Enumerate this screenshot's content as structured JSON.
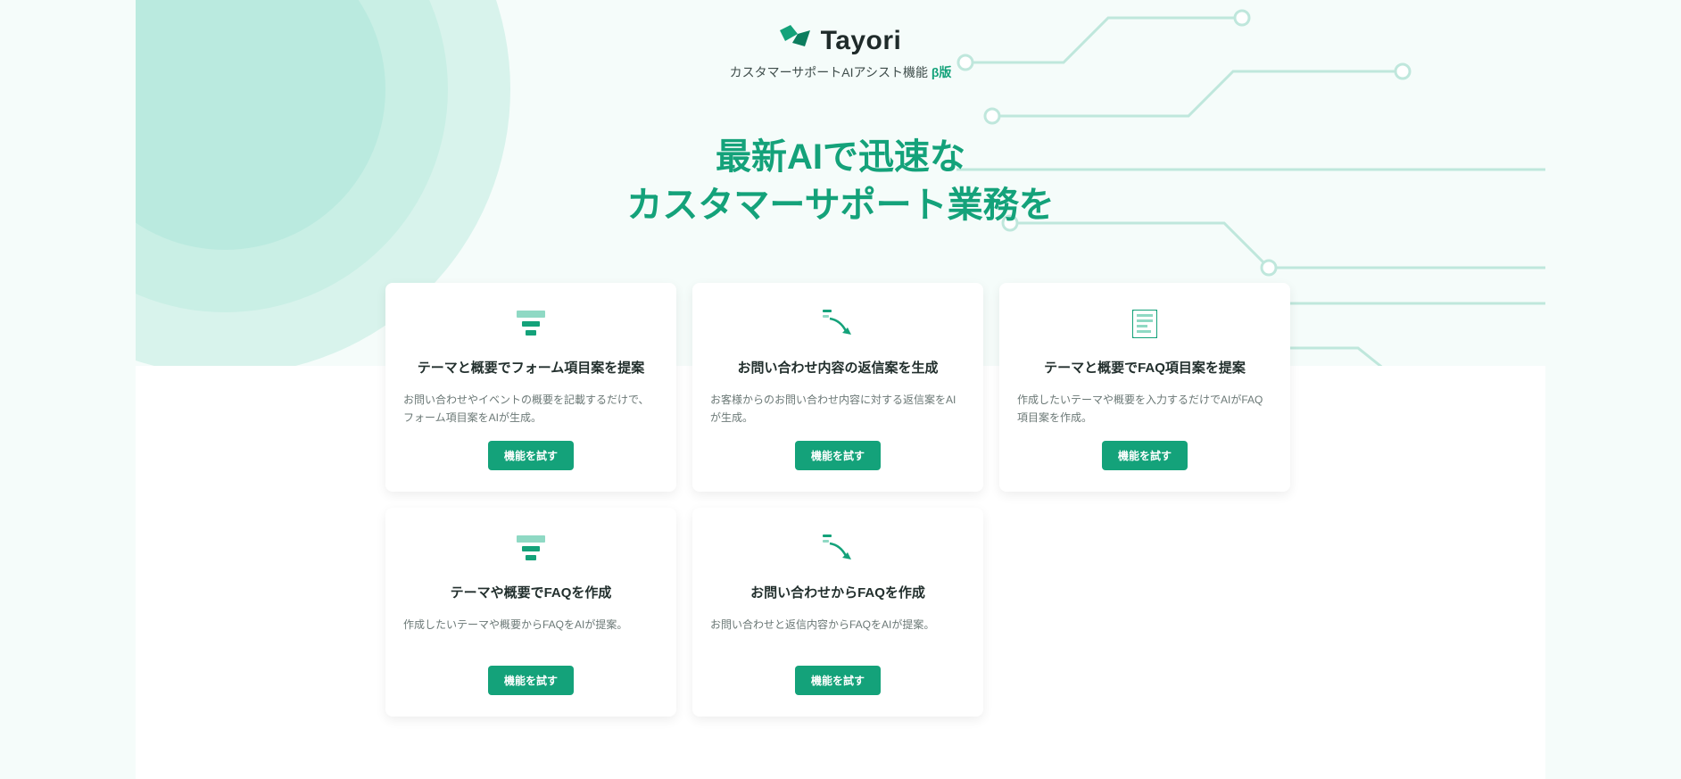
{
  "brand": {
    "name": "Tayori",
    "tagline": "カスタマーサポートAIアシスト機能",
    "beta_label": "β版"
  },
  "headline": {
    "line1": "最新AIで迅速な",
    "line2": "カスタマーサポート業務を"
  },
  "common": {
    "cta_label": "機能を試す"
  },
  "cards": [
    {
      "icon": "form-icon",
      "title": "テーマと概要でフォーム項目案を提案",
      "desc": "お問い合わせやイベントの概要を記載するだけで、フォーム項目案をAIが生成。"
    },
    {
      "icon": "reply-arrow-icon",
      "title": "お問い合わせ内容の返信案を生成",
      "desc": "お客様からのお問い合わせ内容に対する返信案をAIが生成。"
    },
    {
      "icon": "faq-doc-icon",
      "title": "テーマと概要でFAQ項目案を提案",
      "desc": "作成したいテーマや概要を入力するだけでAIがFAQ項目案を作成。"
    },
    {
      "icon": "form-icon",
      "title": "テーマや概要でFAQを作成",
      "desc": "作成したいテーマや概要からFAQをAIが提案。"
    },
    {
      "icon": "reply-arrow-icon",
      "title": "お問い合わせからFAQを作成",
      "desc": "お問い合わせと返信内容からFAQをAIが提案。"
    }
  ]
}
